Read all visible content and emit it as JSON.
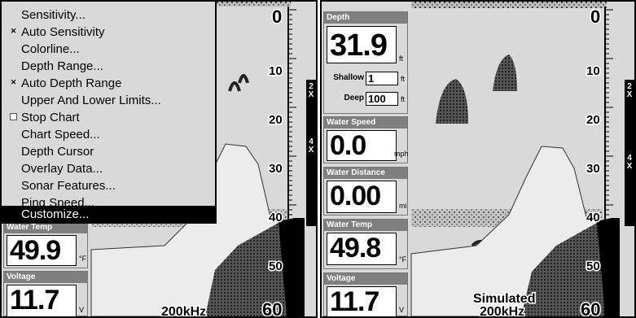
{
  "left_screen": {
    "depth_scale": [
      "0",
      "10",
      "20",
      "30",
      "40",
      "50",
      "60"
    ],
    "frequency": "200kHz",
    "zoom_labels": [
      "2\nX",
      "4\nX"
    ],
    "menu": {
      "items": [
        {
          "label": "Sensitivity...",
          "check": "none",
          "selected": false
        },
        {
          "label": "Auto Sensitivity",
          "check": "checked",
          "selected": false
        },
        {
          "label": "Colorline...",
          "check": "none",
          "selected": false
        },
        {
          "label": "Depth Range...",
          "check": "none",
          "selected": false
        },
        {
          "label": "Auto Depth Range",
          "check": "checked",
          "selected": false
        },
        {
          "label": "Upper And Lower Limits...",
          "check": "none",
          "selected": false
        },
        {
          "label": "Stop Chart",
          "check": "unchecked",
          "selected": false
        },
        {
          "label": "Chart Speed...",
          "check": "none",
          "selected": false
        },
        {
          "label": "Depth Cursor",
          "check": "none",
          "selected": false
        },
        {
          "label": "Overlay Data...",
          "check": "none",
          "selected": false
        },
        {
          "label": "Sonar Features...",
          "check": "none",
          "selected": false
        },
        {
          "label": "Ping Speed...",
          "check": "none",
          "selected": false
        },
        {
          "label": "Customize...",
          "check": "none",
          "selected": true
        }
      ],
      "check_mark": "✕"
    },
    "water_temp": {
      "label": "Water Temp",
      "value": "49.9",
      "unit": "°F"
    },
    "voltage": {
      "label": "Voltage",
      "value": "11.7",
      "unit": "V"
    }
  },
  "right_screen": {
    "depth_scale": [
      "0",
      "10",
      "20",
      "30",
      "40",
      "50",
      "60"
    ],
    "frequency": "200kHz",
    "simulated_label": "Simulated",
    "zoom_labels": [
      "2\nX",
      "4\nX"
    ],
    "depth": {
      "label": "Depth",
      "value": "31.9",
      "unit": "ft"
    },
    "shallow": {
      "label": "Shallow",
      "value": "1",
      "unit": "ft"
    },
    "deep": {
      "label": "Deep",
      "value": "100",
      "unit": "ft"
    },
    "water_speed": {
      "label": "Water Speed",
      "value": "0.0",
      "unit": "mph"
    },
    "water_distance": {
      "label": "Water Distance",
      "value": "0.00",
      "unit": "mi"
    },
    "water_temp": {
      "label": "Water Temp",
      "value": "49.8",
      "unit": "°F"
    },
    "voltage": {
      "label": "Voltage",
      "value": "11.7",
      "unit": "V"
    }
  },
  "colors": {
    "background": "#ffffff",
    "sonar_gray": "#d9d9d9",
    "header_gray": "#7f7f7f",
    "ink": "#000000"
  }
}
